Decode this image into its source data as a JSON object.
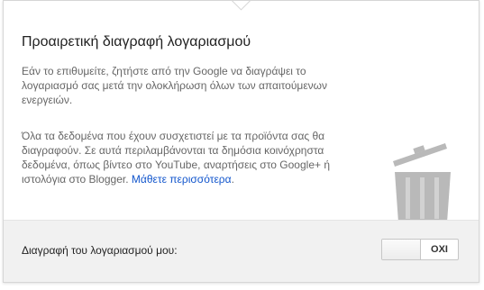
{
  "dialog": {
    "title": "Προαιρετική διαγραφή λογαριασμού",
    "paragraph1": "Εάν το επιθυμείτε, ζητήστε από την Google να διαγράψει το λογαριασμό σας μετά την ολοκλήρωση όλων των απαιτούμενων ενεργειών.",
    "paragraph2_text": "Όλα τα δεδομένα που έχουν συσχετιστεί με τα προϊόντα σας θα διαγραφούν. Σε αυτά περιλαμβάνονται τα δημόσια κοινόχρηστα δεδομένα, όπως βίντεο στο YouTube, αναρτήσεις στο Google+ ή ιστολόγια στο Blogger.",
    "learn_more_link": "Μάθετε περισσότερα",
    "paragraph2_end": ".",
    "illustration_icon": "trash-can-icon"
  },
  "footer": {
    "label": "Διαγραφή του λογαριασμού μου:",
    "toggle": {
      "state_label": "ΟΧΙ",
      "enabled": false
    }
  },
  "colors": {
    "title_text": "#222222",
    "body_text": "#666666",
    "link": "#1155cc",
    "footer_bg": "#f1f1f1",
    "trash_icon": "#b9b9b9"
  }
}
